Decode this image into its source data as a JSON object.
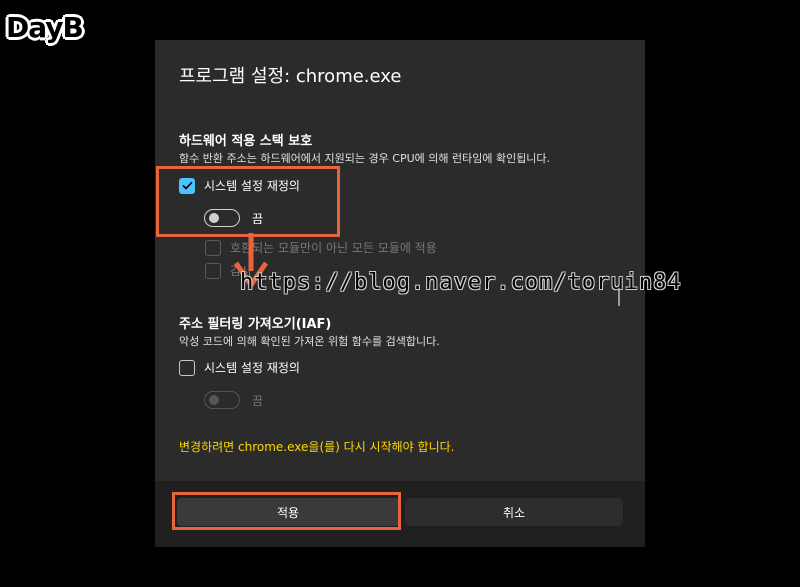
{
  "logo": {
    "text": "DayB"
  },
  "dialog": {
    "title": "프로그램 설정: chrome.exe",
    "section1": {
      "title": "하드웨어 적용 스택 보호",
      "description": "함수 반환 주소는 하드웨어에서 지원되는 경우 CPU에 의해 런타임에 확인됩니다.",
      "override_label": "시스템 설정 재정의",
      "override_checked": true,
      "toggle_label": "끔",
      "sub_option_1": "호환되는 모듈만이 아닌 모든 모듈에 적용",
      "sub_option_2": "감사"
    },
    "section2": {
      "title": "주소 필터링 가져오기(IAF)",
      "description": "악성 코드에 의해 확인된 가져온 위험 함수를 검색합니다.",
      "override_label": "시스템 설정 재정의",
      "override_checked": false,
      "toggle_label": "끔"
    },
    "restart_note": "변경하려면 chrome.exe을(를) 다시 시작해야 합니다.",
    "apply_label": "적용",
    "cancel_label": "취소"
  },
  "watermark": {
    "text": "https://blog.naver.com/toruin84"
  },
  "colors": {
    "accent": "#4cc2ff",
    "highlight": "#e8643c",
    "warning": "#ffd600",
    "dialog_bg": "#2b2b2b",
    "footer_bg": "#202020"
  }
}
